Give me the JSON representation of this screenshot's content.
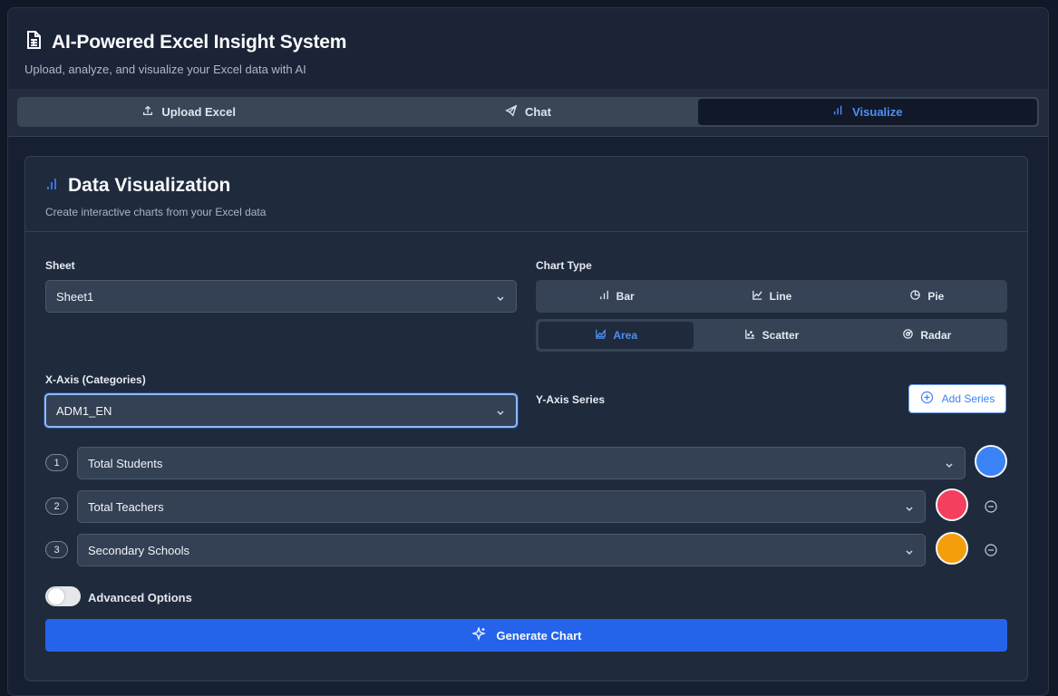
{
  "app": {
    "title": "AI-Powered Excel Insight System",
    "subtitle": "Upload, analyze, and visualize your Excel data with AI",
    "title_icon": "spreadsheet-icon"
  },
  "tabs": [
    {
      "label": "Upload Excel",
      "icon": "upload-icon",
      "active": false
    },
    {
      "label": "Chat",
      "icon": "send-icon",
      "active": false
    },
    {
      "label": "Visualize",
      "icon": "bar-chart-icon",
      "active": true
    }
  ],
  "visualization": {
    "title": "Data Visualization",
    "subtitle": "Create interactive charts from your Excel data",
    "sheet_label": "Sheet",
    "sheet_value": "Sheet1",
    "chart_type_label": "Chart Type",
    "chart_types": [
      {
        "label": "Bar",
        "icon": "bar-chart-icon",
        "active": false
      },
      {
        "label": "Line",
        "icon": "line-chart-icon",
        "active": false
      },
      {
        "label": "Pie",
        "icon": "pie-chart-icon",
        "active": false
      },
      {
        "label": "Area",
        "icon": "area-chart-icon",
        "active": true
      },
      {
        "label": "Scatter",
        "icon": "scatter-chart-icon",
        "active": false
      },
      {
        "label": "Radar",
        "icon": "radar-chart-icon",
        "active": false
      }
    ],
    "x_axis_label": "X-Axis (Categories)",
    "x_axis_value": "ADM1_EN",
    "y_axis_label": "Y-Axis Series",
    "add_series_label": "Add Series",
    "series": [
      {
        "number": "1",
        "value": "Total Students",
        "color": "#3b82f6",
        "removable": false
      },
      {
        "number": "2",
        "value": "Total Teachers",
        "color": "#f43f5e",
        "removable": true
      },
      {
        "number": "3",
        "value": "Secondary Schools",
        "color": "#f59e0b",
        "removable": true
      }
    ],
    "advanced_options_label": "Advanced Options",
    "advanced_enabled": false,
    "generate_label": "Generate Chart"
  }
}
